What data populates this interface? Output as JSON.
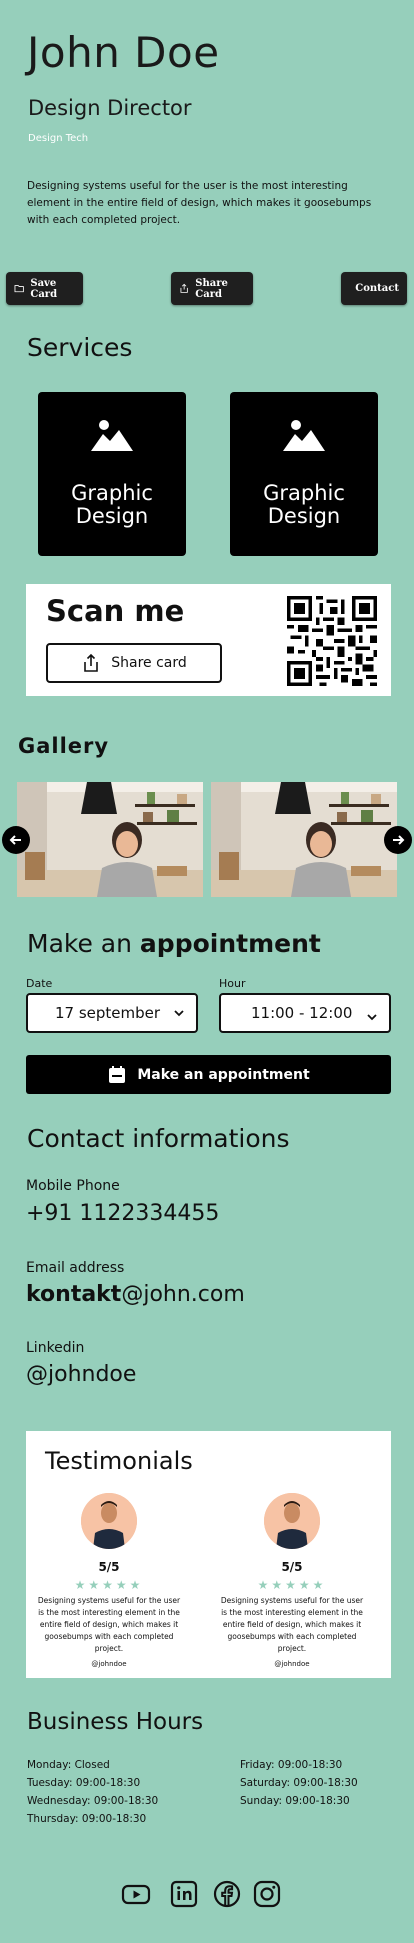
{
  "profile": {
    "name": "John Doe",
    "title": "Design Director",
    "company": "Design Tech",
    "bio": "Designing systems useful for the user is the most interesting element in the entire field of design, which makes it goosebumps with each completed project."
  },
  "actions": {
    "save_label": "Save Card",
    "share_label": "Share Card",
    "contact_label": "Contact"
  },
  "services": {
    "heading": "Services",
    "items": [
      {
        "label": "Graphic Design",
        "icon": "mountain-icon"
      },
      {
        "label": "Graphic Design",
        "icon": "mountain-icon"
      }
    ]
  },
  "scan": {
    "title": "Scan me",
    "share_button": "Share card"
  },
  "gallery": {
    "heading": "Gallery"
  },
  "appointment": {
    "heading_light": "Make an",
    "heading_bold": "appointment",
    "date_label": "Date",
    "date_value": "17 september",
    "hour_label": "Hour",
    "hour_value": "11:00 - 12:00",
    "button": "Make an appointment"
  },
  "contact": {
    "heading": "Contact informations",
    "phone_label": "Mobile Phone",
    "phone_value": "+91 1122334455",
    "email_label": "Email address",
    "email_bold": "kontakt",
    "email_rest": "@john.com",
    "linkedin_label": "Linkedin",
    "linkedin_value": "@johndoe"
  },
  "testimonials": {
    "heading": "Testimonials",
    "items": [
      {
        "score": "5/5",
        "text": "Designing systems useful for the user is the most interesting element in the entire field of design, which makes it goosebumps with each completed project.",
        "handle": "@johndoe",
        "rating": 5
      },
      {
        "score": "5/5",
        "text": "Designing systems useful for the user is the most interesting element in the entire field of design, which makes it goosebumps with each completed project.",
        "handle": "@johndoe",
        "rating": 5
      }
    ]
  },
  "hours": {
    "heading": "Business Hours",
    "left": [
      "Monday: Closed",
      "Tuesday: 09:00-18:30",
      "Wednesday: 09:00-18:30",
      "Thursday: 09:00-18:30"
    ],
    "right": [
      "Friday: 09:00-18:30",
      "Saturday: 09:00-18:30",
      "Sunday: 09:00-18:30"
    ]
  },
  "social": [
    "youtube-icon",
    "linkedin-icon",
    "facebook-icon",
    "instagram-icon"
  ],
  "colors": {
    "background": "#96cfbb",
    "dark": "#000000",
    "star": "#96cfbb"
  }
}
